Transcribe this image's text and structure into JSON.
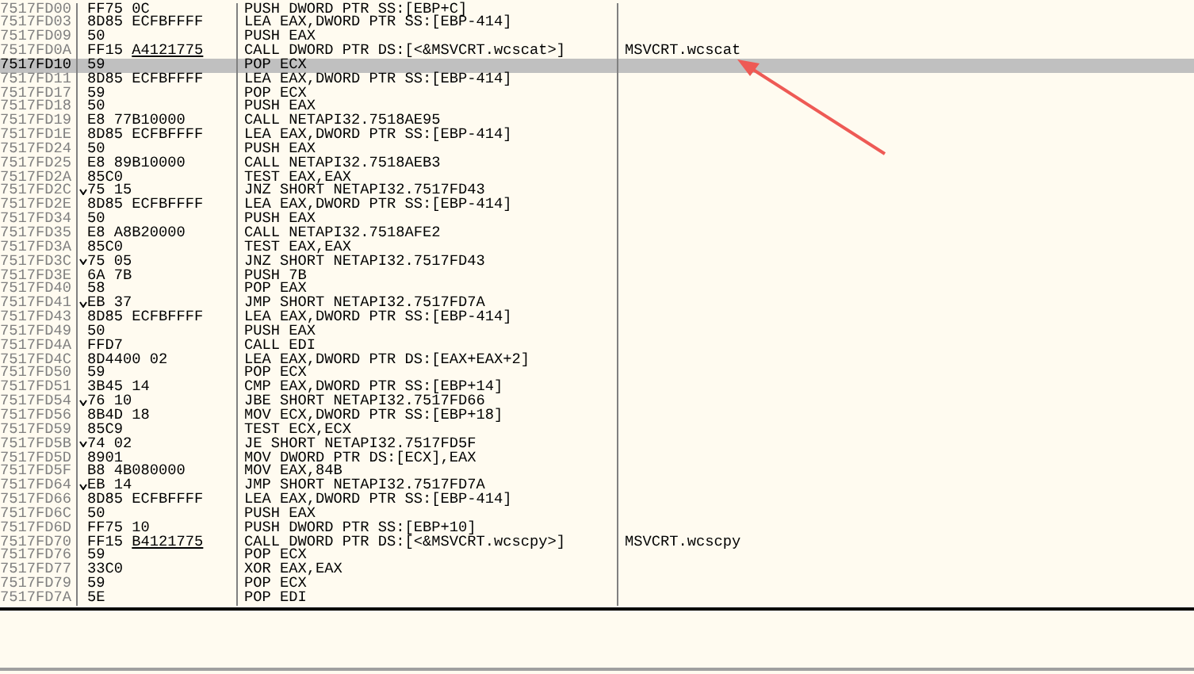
{
  "listing": {
    "rows": [
      {
        "address": "7517FD00",
        "hex": "FF75 0C",
        "instruction": "PUSH DWORD PTR SS:[EBP+C]",
        "jump": false,
        "selected": false
      },
      {
        "address": "7517FD03",
        "hex": "8D85 ECFBFFFF",
        "instruction": "LEA EAX,DWORD PTR SS:[EBP-414]",
        "jump": false,
        "selected": false
      },
      {
        "address": "7517FD09",
        "hex": "50",
        "instruction": "PUSH EAX",
        "jump": false,
        "selected": false
      },
      {
        "address": "7517FD0A",
        "hex": "FF15",
        "fixup": "A4121775",
        "instruction": "CALL DWORD PTR DS:[<&MSVCRT.wcscat>]",
        "comment": "MSVCRT.wcscat",
        "jump": false,
        "selected": false
      },
      {
        "address": "7517FD10",
        "hex": "59",
        "instruction": "POP ECX",
        "jump": false,
        "selected": true
      },
      {
        "address": "7517FD11",
        "hex": "8D85 ECFBFFFF",
        "instruction": "LEA EAX,DWORD PTR SS:[EBP-414]",
        "jump": false,
        "selected": false
      },
      {
        "address": "7517FD17",
        "hex": "59",
        "instruction": "POP ECX",
        "jump": false,
        "selected": false
      },
      {
        "address": "7517FD18",
        "hex": "50",
        "instruction": "PUSH EAX",
        "jump": false,
        "selected": false
      },
      {
        "address": "7517FD19",
        "hex": "E8 77B10000",
        "instruction": "CALL NETAPI32.7518AE95",
        "jump": false,
        "selected": false
      },
      {
        "address": "7517FD1E",
        "hex": "8D85 ECFBFFFF",
        "instruction": "LEA EAX,DWORD PTR SS:[EBP-414]",
        "jump": false,
        "selected": false
      },
      {
        "address": "7517FD24",
        "hex": "50",
        "instruction": "PUSH EAX",
        "jump": false,
        "selected": false
      },
      {
        "address": "7517FD25",
        "hex": "E8 89B10000",
        "instruction": "CALL NETAPI32.7518AEB3",
        "jump": false,
        "selected": false
      },
      {
        "address": "7517FD2A",
        "hex": "85C0",
        "instruction": "TEST EAX,EAX",
        "jump": false,
        "selected": false
      },
      {
        "address": "7517FD2C",
        "hex": "75 15",
        "instruction": "JNZ SHORT NETAPI32.7517FD43",
        "jump": true,
        "selected": false
      },
      {
        "address": "7517FD2E",
        "hex": "8D85 ECFBFFFF",
        "instruction": "LEA EAX,DWORD PTR SS:[EBP-414]",
        "jump": false,
        "selected": false
      },
      {
        "address": "7517FD34",
        "hex": "50",
        "instruction": "PUSH EAX",
        "jump": false,
        "selected": false
      },
      {
        "address": "7517FD35",
        "hex": "E8 A8B20000",
        "instruction": "CALL NETAPI32.7518AFE2",
        "jump": false,
        "selected": false
      },
      {
        "address": "7517FD3A",
        "hex": "85C0",
        "instruction": "TEST EAX,EAX",
        "jump": false,
        "selected": false
      },
      {
        "address": "7517FD3C",
        "hex": "75 05",
        "instruction": "JNZ SHORT NETAPI32.7517FD43",
        "jump": true,
        "selected": false
      },
      {
        "address": "7517FD3E",
        "hex": "6A 7B",
        "instruction": "PUSH 7B",
        "jump": false,
        "selected": false
      },
      {
        "address": "7517FD40",
        "hex": "58",
        "instruction": "POP EAX",
        "jump": false,
        "selected": false
      },
      {
        "address": "7517FD41",
        "hex": "EB 37",
        "instruction": "JMP SHORT NETAPI32.7517FD7A",
        "jump": true,
        "selected": false
      },
      {
        "address": "7517FD43",
        "hex": "8D85 ECFBFFFF",
        "instruction": "LEA EAX,DWORD PTR SS:[EBP-414]",
        "jump": false,
        "selected": false
      },
      {
        "address": "7517FD49",
        "hex": "50",
        "instruction": "PUSH EAX",
        "jump": false,
        "selected": false
      },
      {
        "address": "7517FD4A",
        "hex": "FFD7",
        "instruction": "CALL EDI",
        "jump": false,
        "selected": false
      },
      {
        "address": "7517FD4C",
        "hex": "8D4400 02",
        "instruction": "LEA EAX,DWORD PTR DS:[EAX+EAX+2]",
        "jump": false,
        "selected": false
      },
      {
        "address": "7517FD50",
        "hex": "59",
        "instruction": "POP ECX",
        "jump": false,
        "selected": false
      },
      {
        "address": "7517FD51",
        "hex": "3B45 14",
        "instruction": "CMP EAX,DWORD PTR SS:[EBP+14]",
        "jump": false,
        "selected": false
      },
      {
        "address": "7517FD54",
        "hex": "76 10",
        "instruction": "JBE SHORT NETAPI32.7517FD66",
        "jump": true,
        "selected": false
      },
      {
        "address": "7517FD56",
        "hex": "8B4D 18",
        "instruction": "MOV ECX,DWORD PTR SS:[EBP+18]",
        "jump": false,
        "selected": false
      },
      {
        "address": "7517FD59",
        "hex": "85C9",
        "instruction": "TEST ECX,ECX",
        "jump": false,
        "selected": false
      },
      {
        "address": "7517FD5B",
        "hex": "74 02",
        "instruction": "JE SHORT NETAPI32.7517FD5F",
        "jump": true,
        "selected": false
      },
      {
        "address": "7517FD5D",
        "hex": "8901",
        "instruction": "MOV DWORD PTR DS:[ECX],EAX",
        "jump": false,
        "selected": false
      },
      {
        "address": "7517FD5F",
        "hex": "B8 4B080000",
        "instruction": "MOV EAX,84B",
        "jump": false,
        "selected": false
      },
      {
        "address": "7517FD64",
        "hex": "EB 14",
        "instruction": "JMP SHORT NETAPI32.7517FD7A",
        "jump": true,
        "selected": false
      },
      {
        "address": "7517FD66",
        "hex": "8D85 ECFBFFFF",
        "instruction": "LEA EAX,DWORD PTR SS:[EBP-414]",
        "jump": false,
        "selected": false
      },
      {
        "address": "7517FD6C",
        "hex": "50",
        "instruction": "PUSH EAX",
        "jump": false,
        "selected": false
      },
      {
        "address": "7517FD6D",
        "hex": "FF75 10",
        "instruction": "PUSH DWORD PTR SS:[EBP+10]",
        "jump": false,
        "selected": false
      },
      {
        "address": "7517FD70",
        "hex": "FF15",
        "fixup": "B4121775",
        "instruction": "CALL DWORD PTR DS:[<&MSVCRT.wcscpy>]",
        "comment": "MSVCRT.wcscpy",
        "jump": false,
        "selected": false
      },
      {
        "address": "7517FD76",
        "hex": "59",
        "instruction": "POP ECX",
        "jump": false,
        "selected": false
      },
      {
        "address": "7517FD77",
        "hex": "33C0",
        "instruction": "XOR EAX,EAX",
        "jump": false,
        "selected": false
      },
      {
        "address": "7517FD79",
        "hex": "59",
        "instruction": "POP ECX",
        "jump": false,
        "selected": false
      },
      {
        "address": "7517FD7A",
        "hex": "5E",
        "instruction": "POP EDI",
        "jump": false,
        "selected": false
      }
    ]
  }
}
